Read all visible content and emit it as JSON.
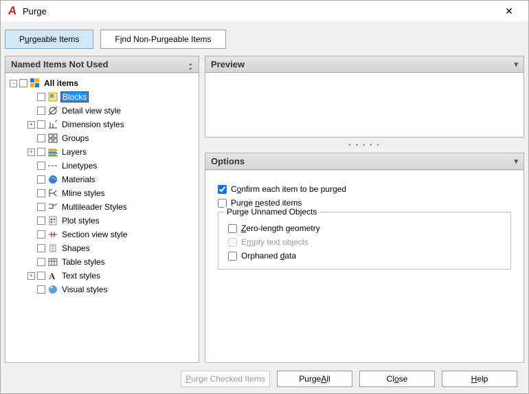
{
  "window": {
    "title": "Purge"
  },
  "tabs": {
    "purgeable_pre": "P",
    "purgeable_u": "u",
    "purgeable_post": "rgeable Items",
    "nonpurge_pre": "F",
    "nonpurge_u": "i",
    "nonpurge_post": "nd Non-Purgeable Items"
  },
  "left": {
    "header": "Named Items Not Used"
  },
  "tree": {
    "root": "All items",
    "items": [
      {
        "label": "Blocks",
        "expander": "",
        "selected": true
      },
      {
        "label": "Detail view style",
        "expander": ""
      },
      {
        "label": "Dimension styles",
        "expander": "+"
      },
      {
        "label": "Groups",
        "expander": ""
      },
      {
        "label": "Layers",
        "expander": "+"
      },
      {
        "label": "Linetypes",
        "expander": ""
      },
      {
        "label": "Materials",
        "expander": ""
      },
      {
        "label": "Mline styles",
        "expander": ""
      },
      {
        "label": "Multileader Styles",
        "expander": ""
      },
      {
        "label": "Plot styles",
        "expander": ""
      },
      {
        "label": "Section view style",
        "expander": ""
      },
      {
        "label": "Shapes",
        "expander": ""
      },
      {
        "label": "Table styles",
        "expander": ""
      },
      {
        "label": "Text styles",
        "expander": "+"
      },
      {
        "label": "Visual styles",
        "expander": ""
      }
    ]
  },
  "preview": {
    "header": "Preview"
  },
  "options": {
    "header": "Options",
    "confirm_pre": "C",
    "confirm_u": "o",
    "confirm_post": "nfirm each item to be purged",
    "nested_pre": "Purge ",
    "nested_u": "n",
    "nested_post": "ested items",
    "group_legend": "Purge Unnamed Objects",
    "zero_pre": "",
    "zero_u": "Z",
    "zero_post": "ero-length geometry",
    "empty_pre": "E",
    "empty_u": "m",
    "empty_post": "pty text objects",
    "orphan_pre": "Orphaned ",
    "orphan_u": "d",
    "orphan_post": "ata"
  },
  "footer": {
    "purge_checked_pre": "",
    "purge_checked_u": "P",
    "purge_checked_post": "urge Checked Items",
    "purge_all_pre": "Purge ",
    "purge_all_u": "A",
    "purge_all_post": "ll",
    "close_pre": "Cl",
    "close_u": "o",
    "close_post": "se",
    "help_pre": "",
    "help_u": "H",
    "help_post": "elp"
  }
}
